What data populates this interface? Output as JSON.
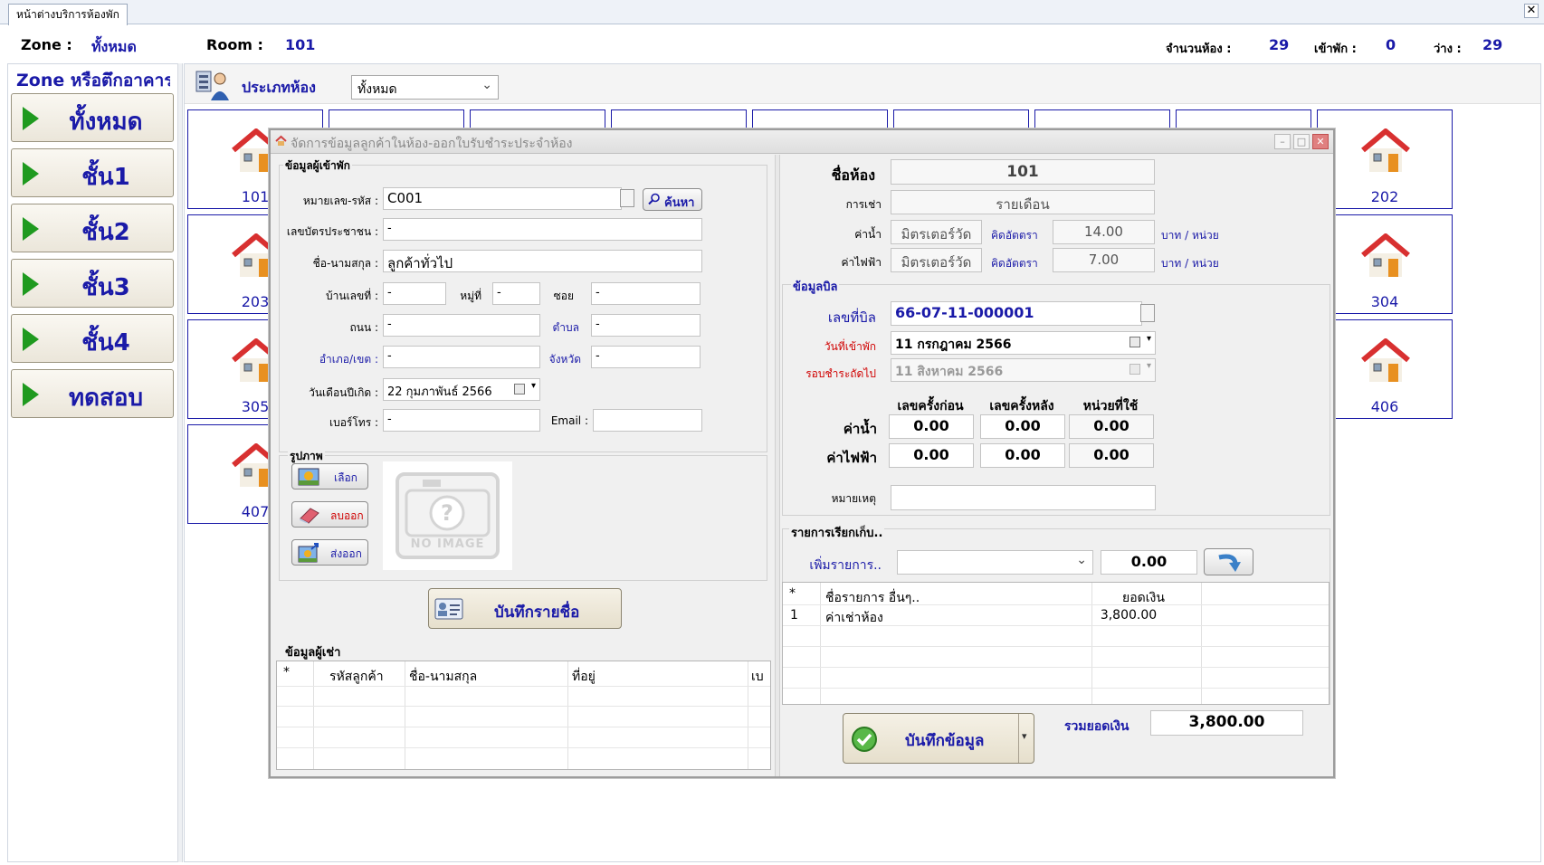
{
  "window": {
    "tab_label": "หน้าต่างบริการห้องพัก",
    "close_glyph": "✕"
  },
  "info": {
    "zone_label": "Zone :",
    "zone_value": "ทั้งหมด",
    "room_label": "Room :",
    "room_value": "101",
    "total_label": "จำนวนห้อง :",
    "total_value": "29",
    "occupied_label": "เข้าพัก :",
    "occupied_value": "0",
    "vacant_label": "ว่าง :",
    "vacant_value": "29"
  },
  "sidebar": {
    "title": "Zone หรือตึกอาคาร",
    "items": [
      {
        "label": "ทั้งหมด"
      },
      {
        "label": "ชั้น1"
      },
      {
        "label": "ชั้น2"
      },
      {
        "label": "ชั้น3"
      },
      {
        "label": "ชั้น4"
      },
      {
        "label": "ทดสอบ"
      }
    ]
  },
  "room_filter": {
    "label": "ประเภทห้อง",
    "selected": "ทั้งหมด",
    "chevron": "⌄"
  },
  "rooms": {
    "left_column": [
      "101",
      "203",
      "305",
      "407"
    ],
    "right_column": [
      "202",
      "304",
      "406"
    ]
  },
  "dialog": {
    "title": "จัดการข้อมูลลูกค้าในห้อง-ออกใบรับชำระประจำห้อง",
    "controls": {
      "minimize": "–",
      "maximize": "□",
      "close": "✕"
    },
    "guest": {
      "group_label": "ข้อมูลผู้เข้าพัก",
      "code_label": "หมายเลข-รหัส :",
      "code_value": "C001",
      "search_button": "ค้นหา",
      "idcard_label": "เลขบัตรประชาชน :",
      "idcard_value": "-",
      "name_label": "ชื่อ-นามสกุล :",
      "name_value": "ลูกค้าทั่วไป",
      "house_label": "บ้านเลขที่ :",
      "house_value": "-",
      "moo_label": "หมู่ที่",
      "moo_value": "-",
      "soi_label": "ซอย",
      "soi_value": "-",
      "road_label": "ถนน :",
      "road_value": "-",
      "subdistrict_label": "ตำบล",
      "subdistrict_value": "-",
      "district_label": "อำเภอ/เขต :",
      "district_value": "-",
      "province_label": "จังหวัด",
      "province_value": "-",
      "birth_label": "วันเดือนปีเกิด :",
      "birth_value": "22 กุมภาพันธ์ 2566",
      "phone_label": "เบอร์โทร :",
      "phone_value": "-",
      "email_label": "Email :",
      "email_value": ""
    },
    "photo": {
      "group_label": "รูปภาพ",
      "choose_button": "เลือก",
      "delete_button": "ลบออก",
      "export_button": "ส่งออก",
      "placeholder_text": "NO IMAGE"
    },
    "save_name_button": "บันทึกรายชื่อ",
    "tenants": {
      "group_label": "ข้อมูลผู้เช่า",
      "columns": [
        "*",
        "รหัสลูกค้า",
        "ชื่อ-นามสกุล",
        "ที่อยู่",
        "เบ"
      ]
    },
    "room": {
      "name_label": "ชื่อห้อง",
      "name_value": "101",
      "rent_label": "การเช่า",
      "rent_value": "รายเดือน",
      "water_label": "ค่าน้ำ",
      "water_type": "มิตรเตอร์วัด",
      "water_rate_label": "คิดอัตตรา",
      "water_rate": "14.00",
      "water_unit": "บาท / หน่วย",
      "elec_label": "ค่าไฟฟ้า",
      "elec_type": "มิตรเตอร์วัด",
      "elec_rate_label": "คิดอัตตรา",
      "elec_rate": "7.00",
      "elec_unit": "บาท / หน่วย"
    },
    "bill": {
      "group_label": "ข้อมูลบิล",
      "bill_no_label": "เลขที่บิล",
      "bill_no_value": "66-07-11-000001",
      "checkin_label": "วันที่เข้าพัก",
      "checkin_value": "11   กรกฎาคม     2566",
      "next_label": "รอบชำระถัดไป",
      "next_value": "11   สิงหาคม     2566",
      "col_before": "เลขครั้งก่อน",
      "col_after": "เลขครั้งหลัง",
      "col_used": "หน่วยที่ใช้",
      "water_row_label": "ค่าน้ำ",
      "water_before": "0.00",
      "water_after": "0.00",
      "water_used": "0.00",
      "elec_row_label": "ค่าไฟฟ้า",
      "elec_before": "0.00",
      "elec_after": "0.00",
      "elec_used": "0.00",
      "note_label": "หมายเหตุ",
      "note_value": ""
    },
    "charges": {
      "group_label": "รายการเรียกเก็บ..",
      "add_label": "เพิ่มรายการ..",
      "add_amount": "0.00",
      "columns": [
        "*",
        "ชื่อรายการ อื่นๆ..",
        "ยอดเงิน"
      ],
      "rows": [
        {
          "no": "1",
          "name": "ค่าเช่าห้อง",
          "amount": "3,800.00"
        }
      ]
    },
    "save_button": "บันทึกข้อมูล",
    "total_label": "รวมยอดเงิน",
    "total_value": "3,800.00"
  },
  "colors": {
    "accent_blue": "#1a1aa8",
    "play_green": "#1f9a1f",
    "alert_red": "#d00000"
  }
}
